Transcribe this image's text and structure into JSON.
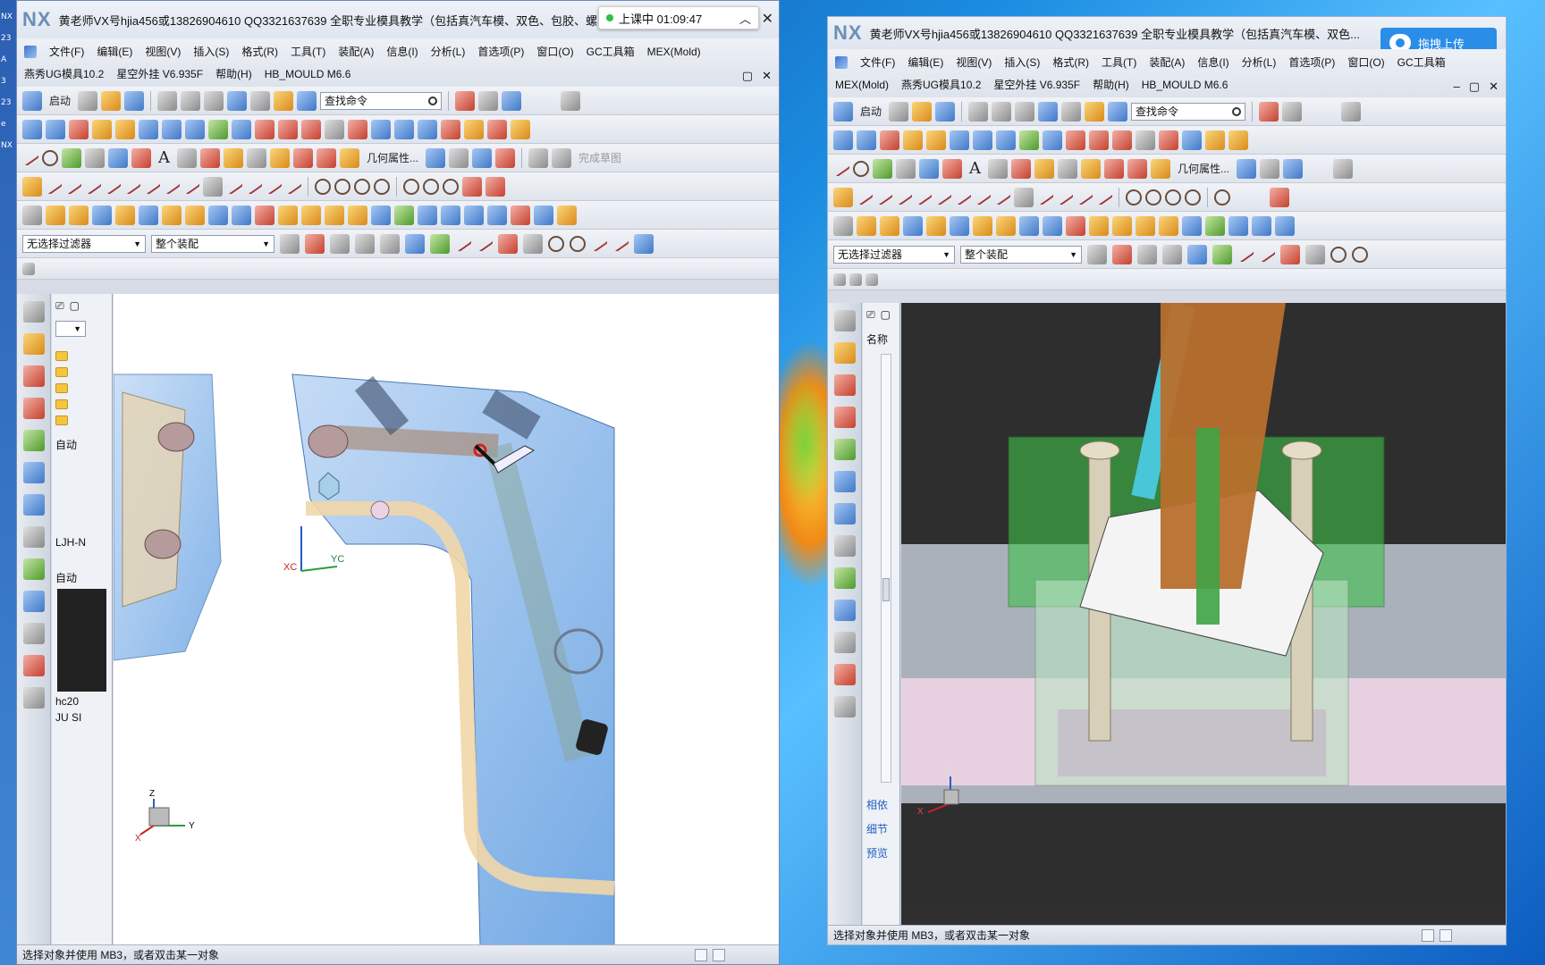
{
  "left_strip": [
    "NX",
    "23",
    "A",
    "3",
    "23",
    "e",
    "NX"
  ],
  "win1": {
    "logo": "NX",
    "title": "黄老师VX号hjia456或13826904610 QQ3321637639 全职专业模具教学（包括真汽车模、双色、包胶、螺",
    "timer": "上课中 01:09:47",
    "menu": [
      "文件(F)",
      "编辑(E)",
      "视图(V)",
      "插入(S)",
      "格式(R)",
      "工具(T)",
      "装配(A)",
      "信息(I)",
      "分析(L)",
      "首选项(P)",
      "窗口(O)",
      "GC工具箱",
      "MEX(Mold)",
      "燕秀UG模具10.2",
      "星空外挂 V6.935F",
      "帮助(H)",
      "HB_MOULD M6.6"
    ],
    "toolbar": {
      "start": "启动",
      "search_placeholder": "查找命令",
      "geom_props": "几何属性...",
      "finish_sketch": "完成草图"
    },
    "filter": "无选择过滤器",
    "assembly": "整个装配",
    "nav_items": [
      "自动",
      "LJH-N",
      "自动",
      "hc20",
      "JU SI"
    ],
    "status": "选择对象并使用 MB3，或者双击某一对象",
    "axis": {
      "xc": "XC",
      "yc": "YC",
      "z": "Z",
      "y": "Y",
      "x": "X"
    }
  },
  "win2": {
    "logo": "NX",
    "title": "黄老师VX号hjia456或13826904610 QQ3321637639 全职专业模具教学（包括真汽车模、双色...",
    "upload": "拖拽上传",
    "menu": [
      "文件(F)",
      "编辑(E)",
      "视图(V)",
      "插入(S)",
      "格式(R)",
      "工具(T)",
      "装配(A)",
      "信息(I)",
      "分析(L)",
      "首选项(P)",
      "窗口(O)",
      "GC工具箱",
      "MEX(Mold)",
      "燕秀UG模具10.2",
      "星空外挂 V6.935F",
      "帮助(H)",
      "HB_MOULD M6.6"
    ],
    "toolbar": {
      "start": "启动",
      "search_placeholder": "查找命令",
      "geom_props": "几何属性..."
    },
    "filter": "无选择过滤器",
    "assembly": "整个装配",
    "nav_header": "名称",
    "nav_sections": [
      "相依",
      "细节",
      "预览"
    ],
    "status": "选择对象并使用 MB3，或者双击某一对象",
    "axis": {
      "z": "Z",
      "x": "X"
    }
  },
  "colors": {
    "mold_blue": "#8fb9ea",
    "mold_green": "#3fbf4a",
    "rod_tan": "#d8cfb8",
    "slider_brown": "#b86f2c",
    "rod_cyan": "#49c6d8",
    "pink": "#f4d7e6"
  }
}
